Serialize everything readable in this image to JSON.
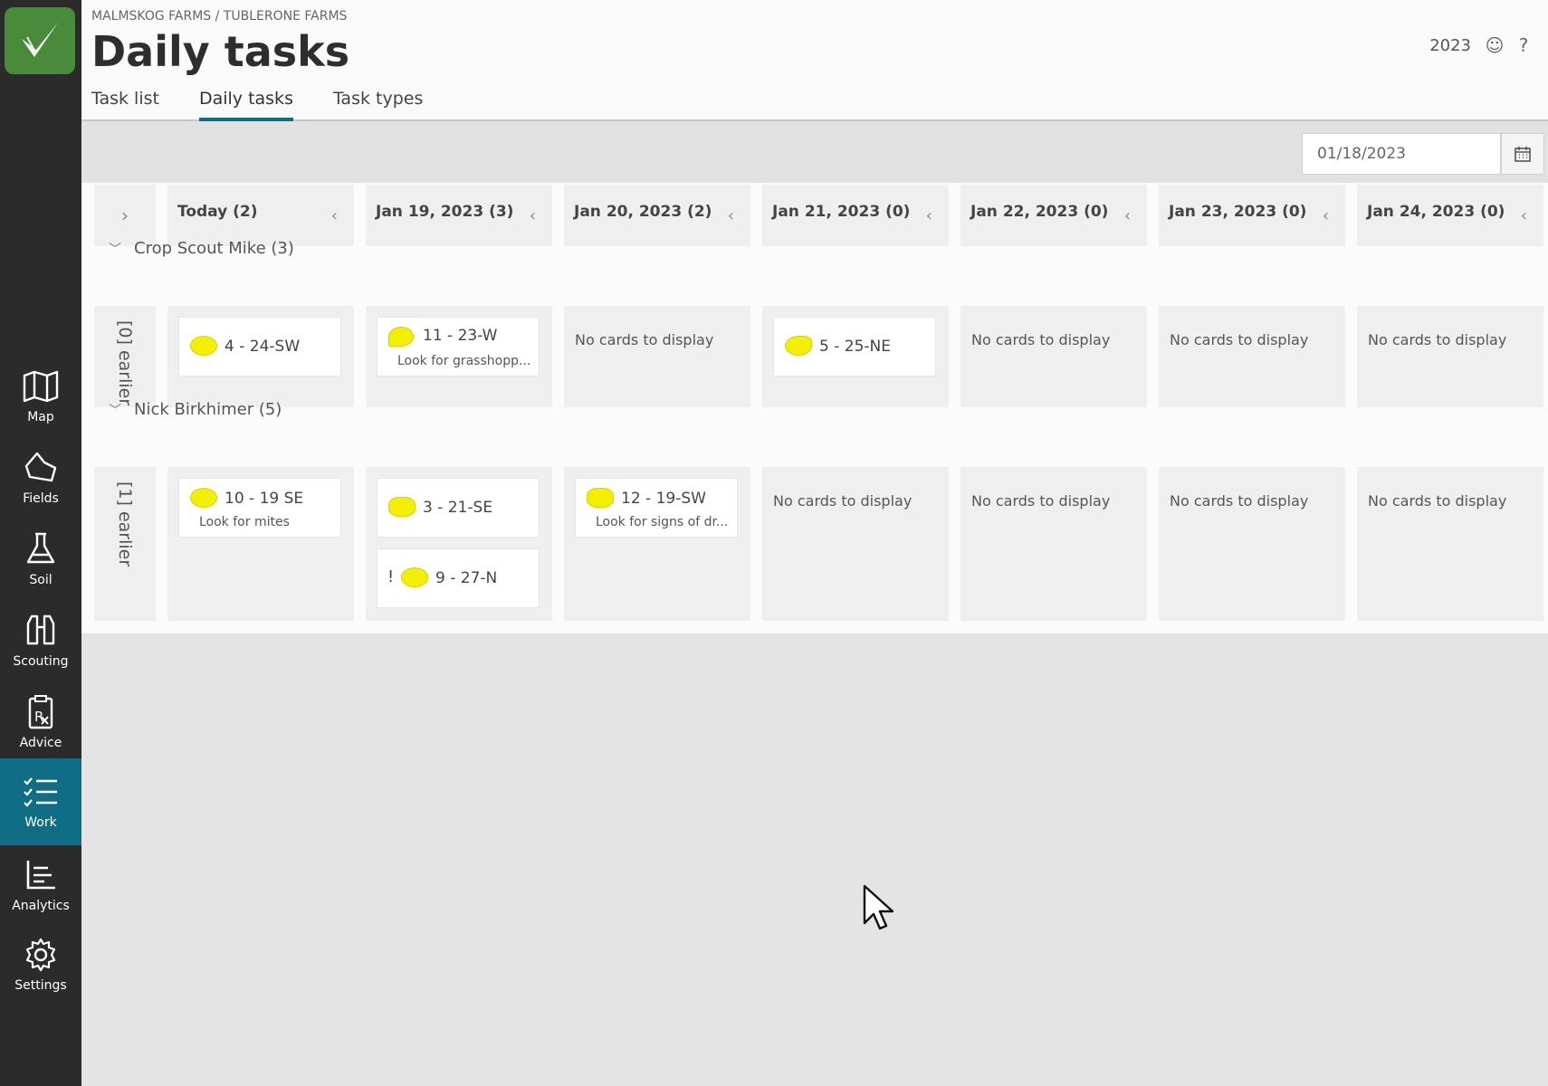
{
  "sidebar": {
    "items": [
      {
        "label": "Map"
      },
      {
        "label": "Fields"
      },
      {
        "label": "Soil"
      },
      {
        "label": "Scouting"
      },
      {
        "label": "Advice"
      },
      {
        "label": "Work"
      },
      {
        "label": "Analytics"
      },
      {
        "label": "Settings"
      }
    ],
    "active": "Work"
  },
  "header": {
    "breadcrumb": "MALMSKOG FARMS / TUBLERONE FARMS",
    "title": "Daily tasks",
    "year": "2023",
    "tabs": [
      {
        "label": "Task list"
      },
      {
        "label": "Daily tasks"
      },
      {
        "label": "Task types"
      }
    ],
    "active_tab": "Daily tasks"
  },
  "toolbar": {
    "date_value": "01/18/2023"
  },
  "board": {
    "columns": [
      {
        "label": "Today (2)"
      },
      {
        "label": "Jan 19, 2023 (3)"
      },
      {
        "label": "Jan 20, 2023 (2)"
      },
      {
        "label": "Jan 21, 2023 (0)"
      },
      {
        "label": "Jan 22, 2023 (0)"
      },
      {
        "label": "Jan 23, 2023 (0)"
      },
      {
        "label": "Jan 24, 2023 (0)"
      }
    ],
    "empty_text": "No cards to display",
    "groups": [
      {
        "name": "Crop Scout Mike (3)",
        "earlier": "[0] earlier",
        "cells": [
          [
            {
              "title": "4 - 24-SW",
              "sub": ""
            }
          ],
          [
            {
              "title": "11 - 23-W",
              "sub": "Look for grasshopp..."
            }
          ],
          [],
          [
            {
              "title": "5 - 25-NE",
              "sub": ""
            }
          ],
          [],
          [],
          []
        ]
      },
      {
        "name": "Nick Birkhimer (5)",
        "earlier": "[1] earlier",
        "cells": [
          [
            {
              "title": "10 - 19 SE",
              "sub": "Look for mites"
            }
          ],
          [
            {
              "title": "3 - 21-SE",
              "sub": ""
            },
            {
              "title": "9 - 27-N",
              "sub": "",
              "flag": "!"
            }
          ],
          [
            {
              "title": "12 - 19-SW",
              "sub": "Look for signs of dr..."
            }
          ],
          [],
          [],
          [],
          []
        ]
      }
    ]
  },
  "colors": {
    "sidebar": "#2b2b2b",
    "accent": "#0f6e85",
    "field_shape": "#f2f000"
  }
}
